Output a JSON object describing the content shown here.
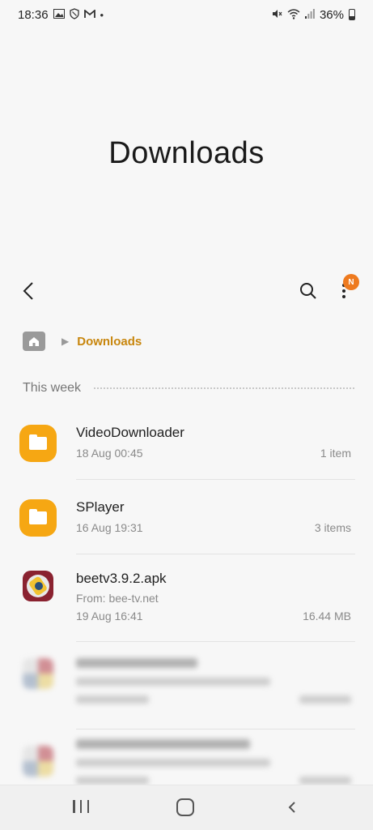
{
  "status_bar": {
    "time": "18:36",
    "left_icons": [
      "image-icon",
      "shield-icon",
      "gmail-icon",
      "dot-icon"
    ],
    "right_icons": [
      "mute-icon",
      "wifi-icon",
      "signal-icon"
    ],
    "battery": "36%"
  },
  "page": {
    "title": "Downloads"
  },
  "toolbar": {
    "badge": "N"
  },
  "breadcrumb": {
    "current": "Downloads"
  },
  "section": {
    "title": "This week"
  },
  "files": [
    {
      "name": "VideoDownloader",
      "date": "18 Aug 00:45",
      "meta": "1 item",
      "type": "folder"
    },
    {
      "name": "SPlayer",
      "date": "16 Aug 19:31",
      "meta": "3 items",
      "type": "folder"
    },
    {
      "name": "beetv3.9.2.apk",
      "source": "From: bee-tv.net",
      "date": "19 Aug 16:41",
      "meta": "16.44 MB",
      "type": "apk"
    }
  ],
  "colors": {
    "folder": "#f6a713",
    "accent": "#c8860d",
    "badge": "#ee7a1f"
  }
}
